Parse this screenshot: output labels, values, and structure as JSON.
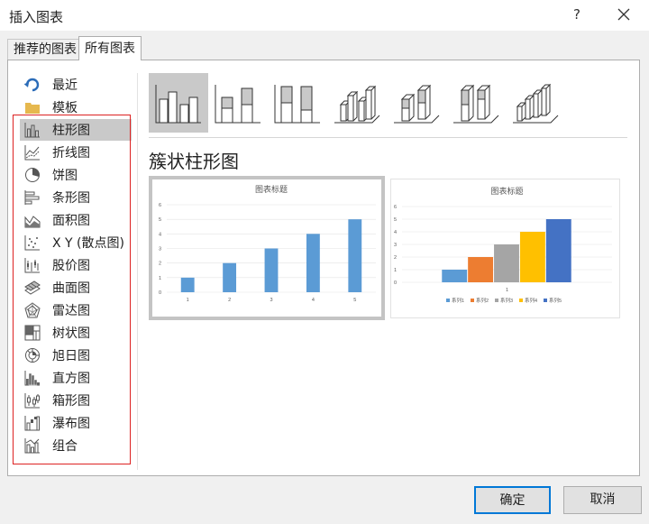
{
  "window": {
    "title": "插入图表",
    "help_label": "?"
  },
  "tabs": [
    {
      "label": "推荐的图表"
    },
    {
      "label": "所有图表"
    }
  ],
  "sidebar": {
    "items": [
      {
        "label": "最近",
        "icon": "recent-icon"
      },
      {
        "label": "模板",
        "icon": "template-folder-icon"
      },
      {
        "label": "柱形图",
        "icon": "column-chart-icon",
        "selected": true
      },
      {
        "label": "折线图",
        "icon": "line-chart-icon"
      },
      {
        "label": "饼图",
        "icon": "pie-chart-icon"
      },
      {
        "label": "条形图",
        "icon": "bar-chart-icon"
      },
      {
        "label": "面积图",
        "icon": "area-chart-icon"
      },
      {
        "label": "X Y (散点图)",
        "icon": "scatter-chart-icon"
      },
      {
        "label": "股价图",
        "icon": "stock-chart-icon"
      },
      {
        "label": "曲面图",
        "icon": "surface-chart-icon"
      },
      {
        "label": "雷达图",
        "icon": "radar-chart-icon"
      },
      {
        "label": "树状图",
        "icon": "treemap-chart-icon"
      },
      {
        "label": "旭日图",
        "icon": "sunburst-chart-icon"
      },
      {
        "label": "直方图",
        "icon": "histogram-chart-icon"
      },
      {
        "label": "箱形图",
        "icon": "box-whisker-chart-icon"
      },
      {
        "label": "瀑布图",
        "icon": "waterfall-chart-icon"
      },
      {
        "label": "组合",
        "icon": "combo-chart-icon"
      }
    ]
  },
  "subtypes": [
    {
      "icon": "clustered-column-icon",
      "selected": true
    },
    {
      "icon": "stacked-column-icon"
    },
    {
      "icon": "100-stacked-column-icon"
    },
    {
      "icon": "3d-clustered-column-icon"
    },
    {
      "icon": "3d-stacked-column-icon"
    },
    {
      "icon": "3d-100-stacked-column-icon"
    },
    {
      "icon": "3d-column-icon"
    }
  ],
  "main": {
    "heading": "簇状柱形图"
  },
  "chart_data": [
    {
      "type": "bar",
      "title": "图表标题",
      "categories": [
        "1",
        "2",
        "3",
        "4",
        "5"
      ],
      "values": [
        1,
        2,
        3,
        4,
        5
      ],
      "ylim": [
        0,
        6
      ],
      "yticks": [
        "0",
        "1",
        "2",
        "3",
        "4",
        "5",
        "6"
      ],
      "grid": true,
      "colors": [
        "#5b9bd5"
      ]
    },
    {
      "type": "bar",
      "title": "图表标题",
      "categories": [
        "1"
      ],
      "series": [
        {
          "name": "系列1",
          "values": [
            1
          ],
          "color": "#5b9bd5"
        },
        {
          "name": "系列2",
          "values": [
            2
          ],
          "color": "#ed7d31"
        },
        {
          "name": "系列3",
          "values": [
            3
          ],
          "color": "#a5a5a5"
        },
        {
          "name": "系列4",
          "values": [
            4
          ],
          "color": "#ffc000"
        },
        {
          "name": "系列5",
          "values": [
            5
          ],
          "color": "#4472c4"
        }
      ],
      "ylim": [
        0,
        6
      ],
      "yticks": [
        "0",
        "1",
        "2",
        "3",
        "4",
        "5",
        "6"
      ],
      "grid": true,
      "legend": "bottom"
    }
  ],
  "footer": {
    "ok_label": "确定",
    "cancel_label": "取消"
  }
}
